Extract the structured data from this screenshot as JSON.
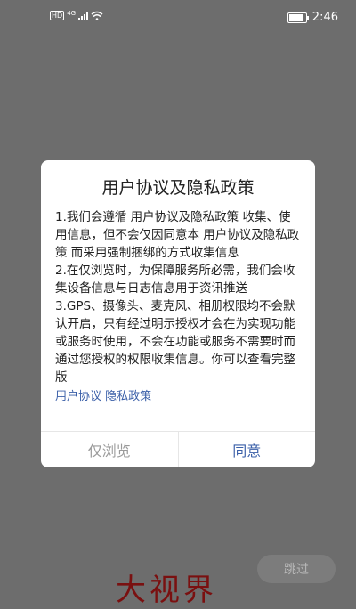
{
  "status_bar": {
    "hd_label": "HD",
    "network_label": "4G",
    "time": "2:46"
  },
  "dialog": {
    "title": "用户协议及隐私政策",
    "paragraphs": [
      "1.我们会遵循 用户协议及隐私政策 收集、使用信息，但不会仅因同意本 用户协议及隐私政策 而采用强制捆绑的方式收集信息",
      "2.在仅浏览时，为保障服务所必需，我们会收集设备信息与日志信息用于资讯推送",
      "3.GPS、摄像头、麦克风、相册权限均不会默认开启，只有经过明示授权才会在为实现功能或服务时使用，不会在功能或服务不需要时而通过您授权的权限收集信息。你可以查看完整版"
    ],
    "link_user_agreement": "用户协议",
    "link_privacy_policy": "隐私政策",
    "btn_browse_only": "仅浏览",
    "btn_agree": "同意"
  },
  "skip_button": "跳过",
  "brand_text": "大视界"
}
